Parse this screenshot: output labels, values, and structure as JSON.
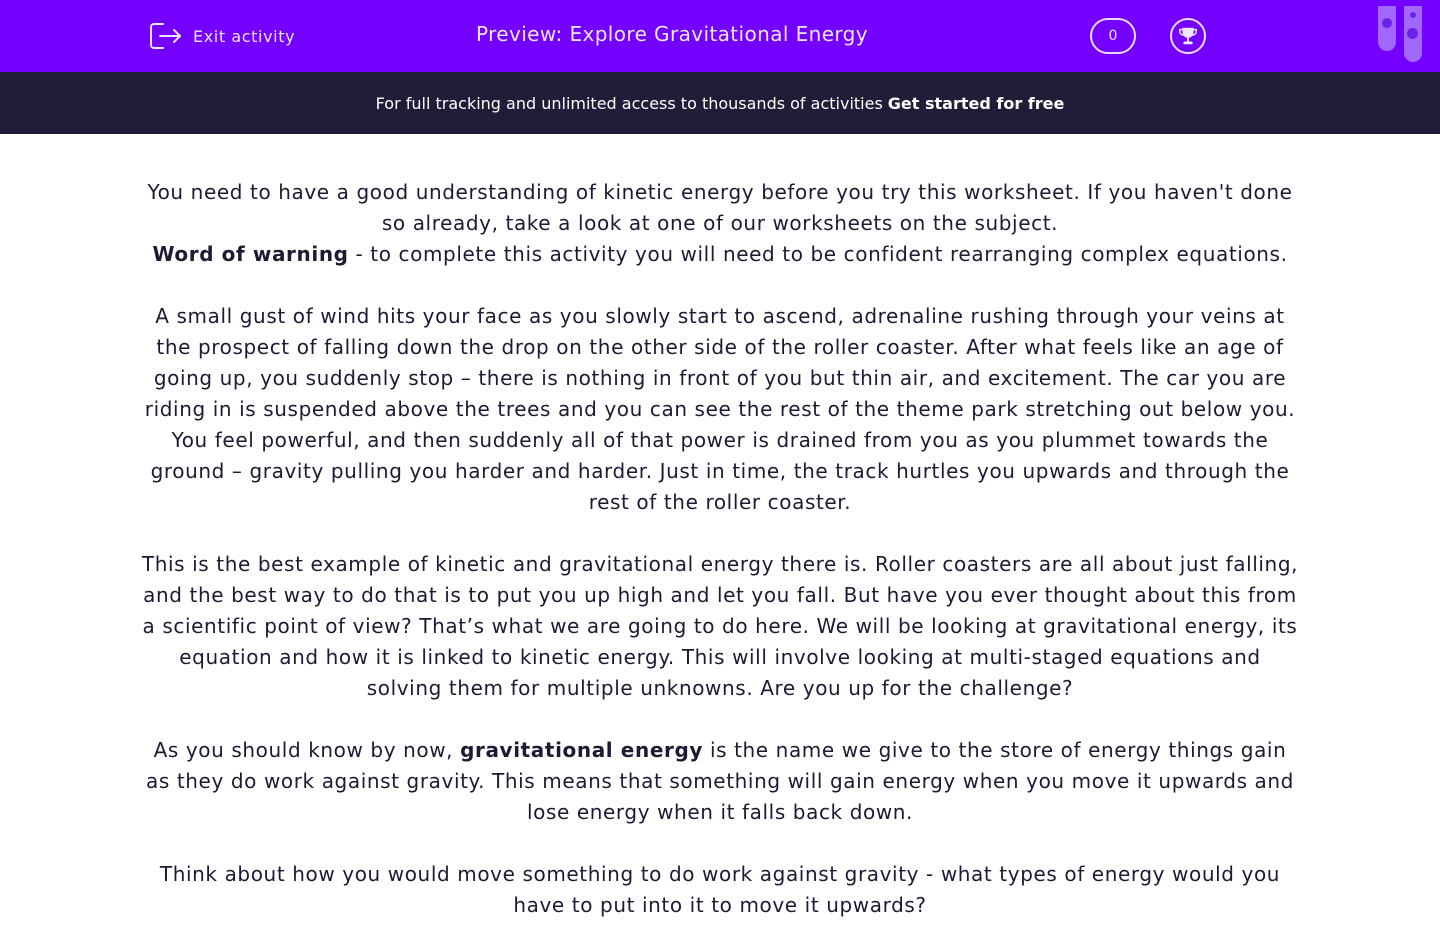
{
  "header": {
    "exit_label": "Exit activity",
    "title": "Preview: Explore Gravitational Energy",
    "score": "0",
    "bg_color": "#7400ff"
  },
  "banner": {
    "text": "For full tracking and unlimited access to thousands of activities",
    "cta": "Get started for free",
    "bg_color": "#231c38"
  },
  "content": {
    "intro": "You need to have a good understanding of kinetic energy before you try this worksheet. If you haven't done so already, take a look at one of our worksheets on the subject.",
    "warning_bold": "Word of warning",
    "warning_text": " - to complete this activity you will need to be confident rearranging complex equations.",
    "p1": "A small gust of wind hits your face as you slowly start to ascend, adrenaline rushing through your veins at the prospect of falling down the drop on the other side of the roller coaster. After what feels like an age of going up, you suddenly stop – there is nothing in front of you but thin air, and excitement. The car you are riding in is suspended above the trees and you can see the rest of the theme park stretching out below you. You feel powerful, and then suddenly all of that power is drained from you as you plummet towards the ground – gravity pulling you harder and harder. Just in time, the track hurtles you upwards and through the rest of the roller coaster.",
    "p2": "This is the best example of kinetic and gravitational energy there is. Roller coasters are all about just falling, and the best way to do that is to put you up high and let you fall. But have you ever thought about this from a scientific point of view? That’s what we are going to do here. We will be looking at gravitational energy, its equation and how it is linked to kinetic energy. This will involve looking at multi-staged equations and solving them for multiple unknowns. Are you up for the challenge?",
    "p3_a": "As you should know by now, ",
    "p3_bold": "gravitational energy",
    "p3_b": " is the name we give to the store of energy things gain as they do work against gravity. This means that something will gain energy when you move it upwards and lose energy when it falls back down.",
    "p4": "Think about how you would move something to do work against gravity - what types of energy would you have to put into it to move it upwards?"
  }
}
